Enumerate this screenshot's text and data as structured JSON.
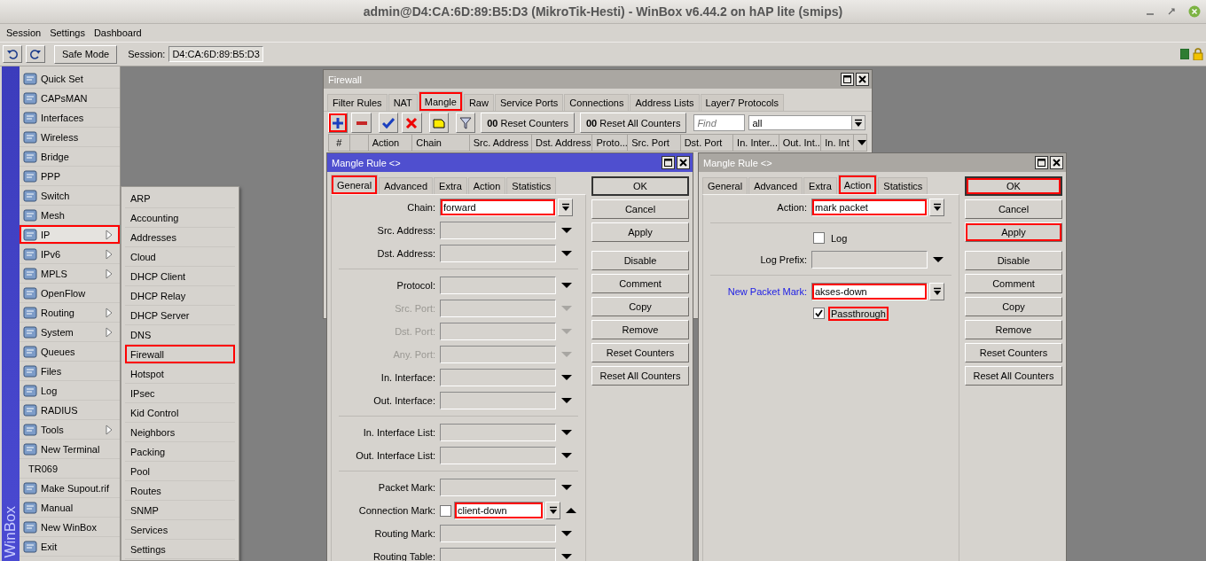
{
  "window": {
    "title": "admin@D4:CA:6D:89:B5:D3 (MikroTik-Hesti) - WinBox v6.44.2 on hAP lite (smips)"
  },
  "menu_bar": [
    "Session",
    "Settings",
    "Dashboard"
  ],
  "toolbar": {
    "safe_mode": "Safe Mode",
    "session_label": "Session:",
    "session_value": "D4:CA:6D:89:B5:D3"
  },
  "sidebar": {
    "brand": "WinBox",
    "items": [
      {
        "label": "Quick Set",
        "icon": true,
        "submenu": false,
        "selected": false,
        "highlighted": false
      },
      {
        "label": "CAPsMAN",
        "icon": true,
        "submenu": false,
        "selected": false,
        "highlighted": false
      },
      {
        "label": "Interfaces",
        "icon": true,
        "submenu": false,
        "selected": false,
        "highlighted": false
      },
      {
        "label": "Wireless",
        "icon": true,
        "submenu": false,
        "selected": false,
        "highlighted": false
      },
      {
        "label": "Bridge",
        "icon": true,
        "submenu": false,
        "selected": false,
        "highlighted": false
      },
      {
        "label": "PPP",
        "icon": true,
        "submenu": false,
        "selected": false,
        "highlighted": false
      },
      {
        "label": "Switch",
        "icon": true,
        "submenu": false,
        "selected": false,
        "highlighted": false
      },
      {
        "label": "Mesh",
        "icon": true,
        "submenu": false,
        "selected": false,
        "highlighted": false
      },
      {
        "label": "IP",
        "icon": true,
        "submenu": true,
        "selected": true,
        "highlighted": true
      },
      {
        "label": "IPv6",
        "icon": true,
        "submenu": true,
        "selected": false,
        "highlighted": false
      },
      {
        "label": "MPLS",
        "icon": true,
        "submenu": true,
        "selected": false,
        "highlighted": false
      },
      {
        "label": "OpenFlow",
        "icon": true,
        "submenu": false,
        "selected": false,
        "highlighted": false
      },
      {
        "label": "Routing",
        "icon": true,
        "submenu": true,
        "selected": false,
        "highlighted": false
      },
      {
        "label": "System",
        "icon": true,
        "submenu": true,
        "selected": false,
        "highlighted": false
      },
      {
        "label": "Queues",
        "icon": true,
        "submenu": false,
        "selected": false,
        "highlighted": false
      },
      {
        "label": "Files",
        "icon": true,
        "submenu": false,
        "selected": false,
        "highlighted": false
      },
      {
        "label": "Log",
        "icon": true,
        "submenu": false,
        "selected": false,
        "highlighted": false
      },
      {
        "label": "RADIUS",
        "icon": true,
        "submenu": false,
        "selected": false,
        "highlighted": false
      },
      {
        "label": "Tools",
        "icon": true,
        "submenu": true,
        "selected": false,
        "highlighted": false
      },
      {
        "label": "New Terminal",
        "icon": true,
        "submenu": false,
        "selected": false,
        "highlighted": false
      },
      {
        "label": "TR069",
        "icon": false,
        "submenu": false,
        "selected": false,
        "highlighted": false
      },
      {
        "label": "Make Supout.rif",
        "icon": true,
        "submenu": false,
        "selected": false,
        "highlighted": false
      },
      {
        "label": "Manual",
        "icon": true,
        "submenu": false,
        "selected": false,
        "highlighted": false
      },
      {
        "label": "New WinBox",
        "icon": true,
        "submenu": false,
        "selected": false,
        "highlighted": false
      },
      {
        "label": "Exit",
        "icon": true,
        "submenu": false,
        "selected": false,
        "highlighted": false
      }
    ]
  },
  "ip_menu": {
    "items": [
      {
        "label": "ARP",
        "highlighted": false
      },
      {
        "label": "Accounting",
        "highlighted": false
      },
      {
        "label": "Addresses",
        "highlighted": false
      },
      {
        "label": "Cloud",
        "highlighted": false
      },
      {
        "label": "DHCP Client",
        "highlighted": false
      },
      {
        "label": "DHCP Relay",
        "highlighted": false
      },
      {
        "label": "DHCP Server",
        "highlighted": false
      },
      {
        "label": "DNS",
        "highlighted": false
      },
      {
        "label": "Firewall",
        "highlighted": true
      },
      {
        "label": "Hotspot",
        "highlighted": false
      },
      {
        "label": "IPsec",
        "highlighted": false
      },
      {
        "label": "Kid Control",
        "highlighted": false
      },
      {
        "label": "Neighbors",
        "highlighted": false
      },
      {
        "label": "Packing",
        "highlighted": false
      },
      {
        "label": "Pool",
        "highlighted": false
      },
      {
        "label": "Routes",
        "highlighted": false
      },
      {
        "label": "SNMP",
        "highlighted": false
      },
      {
        "label": "Services",
        "highlighted": false
      },
      {
        "label": "Settings",
        "highlighted": false
      }
    ]
  },
  "firewall": {
    "title": "Firewall",
    "active": false,
    "tabs": [
      {
        "label": "Filter Rules",
        "selected": false,
        "highlighted": false
      },
      {
        "label": "NAT",
        "selected": false,
        "highlighted": false
      },
      {
        "label": "Mangle",
        "selected": true,
        "highlighted": true
      },
      {
        "label": "Raw",
        "selected": false,
        "highlighted": false
      },
      {
        "label": "Service Ports",
        "selected": false,
        "highlighted": false
      },
      {
        "label": "Connections",
        "selected": false,
        "highlighted": false
      },
      {
        "label": "Address Lists",
        "selected": false,
        "highlighted": false
      },
      {
        "label": "Layer7 Protocols",
        "selected": false,
        "highlighted": false
      }
    ],
    "tools": [
      {
        "kind": "add",
        "highlighted": true
      },
      {
        "kind": "remove",
        "highlighted": false
      },
      {
        "kind": "enable",
        "highlighted": false
      },
      {
        "kind": "disable",
        "highlighted": false
      },
      {
        "kind": "comment",
        "highlighted": false
      },
      {
        "kind": "filter",
        "highlighted": false
      }
    ],
    "counter_buttons": [
      {
        "prefix": "00",
        "label": "Reset Counters"
      },
      {
        "prefix": "00",
        "label": "Reset All Counters"
      }
    ],
    "find": {
      "placeholder": "Find"
    },
    "filter_value": "all",
    "columns": [
      "#",
      "Action",
      "Chain",
      "Src. Address",
      "Dst. Address",
      "Proto...",
      "Src. Port",
      "Dst. Port",
      "In. Inter...",
      "Out. Int...",
      "In. Int"
    ]
  },
  "dialogs": [
    {
      "title": "Mangle Rule <>",
      "active": true,
      "tabs": [
        {
          "label": "General",
          "selected": true,
          "highlighted": true
        },
        {
          "label": "Advanced",
          "selected": false,
          "highlighted": false
        },
        {
          "label": "Extra",
          "selected": false,
          "highlighted": false
        },
        {
          "label": "Action",
          "selected": false,
          "highlighted": false
        },
        {
          "label": "Statistics",
          "selected": false,
          "highlighted": false
        }
      ],
      "rows": [
        {
          "kind": "combo",
          "label": "Chain:",
          "value": "forward",
          "disabled": false,
          "highlighted": true
        },
        {
          "kind": "select",
          "label": "Src. Address:",
          "disabled": false,
          "highlighted": false
        },
        {
          "kind": "select",
          "label": "Dst. Address:",
          "disabled": false,
          "highlighted": false
        },
        {
          "kind": "separator"
        },
        {
          "kind": "select",
          "label": "Protocol:",
          "disabled": false,
          "highlighted": false
        },
        {
          "kind": "select",
          "label": "Src. Port:",
          "disabled": true,
          "highlighted": false
        },
        {
          "kind": "select",
          "label": "Dst. Port:",
          "disabled": true,
          "highlighted": false
        },
        {
          "kind": "select",
          "label": "Any. Port:",
          "disabled": true,
          "highlighted": false
        },
        {
          "kind": "select",
          "label": "In. Interface:",
          "disabled": false,
          "highlighted": false
        },
        {
          "kind": "select",
          "label": "Out. Interface:",
          "disabled": false,
          "highlighted": false
        },
        {
          "kind": "separator"
        },
        {
          "kind": "select",
          "label": "In. Interface List:",
          "disabled": false,
          "highlighted": false
        },
        {
          "kind": "select",
          "label": "Out. Interface List:",
          "disabled": false,
          "highlighted": false
        },
        {
          "kind": "separator"
        },
        {
          "kind": "select",
          "label": "Packet Mark:",
          "disabled": false,
          "highlighted": false
        },
        {
          "kind": "combo",
          "label": "Connection Mark:",
          "value": "client-down",
          "negate": {
            "checked": false
          },
          "expanded": true,
          "disabled": false,
          "highlighted": true
        },
        {
          "kind": "select",
          "label": "Routing Mark:",
          "disabled": false,
          "highlighted": false
        },
        {
          "kind": "select",
          "label": "Routing Table:",
          "disabled": false,
          "highlighted": false
        }
      ],
      "button_groups": [
        [
          {
            "label": "OK",
            "default": true,
            "highlighted": false
          },
          {
            "label": "Cancel",
            "default": false,
            "highlighted": false
          },
          {
            "label": "Apply",
            "default": false,
            "highlighted": false
          }
        ],
        [
          {
            "label": "Disable",
            "default": false,
            "highlighted": false
          },
          {
            "label": "Comment",
            "default": false,
            "highlighted": false
          },
          {
            "label": "Copy",
            "default": false,
            "highlighted": false
          },
          {
            "label": "Remove",
            "default": false,
            "highlighted": false
          },
          {
            "label": "Reset Counters",
            "default": false,
            "highlighted": false
          },
          {
            "label": "Reset All Counters",
            "default": false,
            "highlighted": false
          }
        ]
      ]
    },
    {
      "title": "Mangle Rule <>",
      "active": false,
      "tabs": [
        {
          "label": "General",
          "selected": false,
          "highlighted": false
        },
        {
          "label": "Advanced",
          "selected": false,
          "highlighted": false
        },
        {
          "label": "Extra",
          "selected": false,
          "highlighted": false
        },
        {
          "label": "Action",
          "selected": true,
          "highlighted": true
        },
        {
          "label": "Statistics",
          "selected": false,
          "highlighted": false
        }
      ],
      "rows": [
        {
          "kind": "combo",
          "label": "Action:",
          "value": "mark packet",
          "disabled": false,
          "highlighted": true
        },
        {
          "kind": "separator"
        },
        {
          "kind": "checkbox",
          "label": "Log",
          "checked": false,
          "highlighted": false
        },
        {
          "kind": "select",
          "label": "Log Prefix:",
          "disabled": false,
          "highlighted": false
        },
        {
          "kind": "separator"
        },
        {
          "kind": "combo",
          "label": "New Packet Mark:",
          "value": "akses-down",
          "emphasized": true,
          "disabled": false,
          "highlighted": true
        },
        {
          "kind": "checkbox",
          "label": "Passthrough",
          "checked": true,
          "highlighted": true
        }
      ],
      "button_groups": [
        [
          {
            "label": "OK",
            "default": true,
            "highlighted": true
          },
          {
            "label": "Cancel",
            "default": false,
            "highlighted": false
          },
          {
            "label": "Apply",
            "default": false,
            "highlighted": true
          }
        ],
        [
          {
            "label": "Disable",
            "default": false,
            "highlighted": false
          },
          {
            "label": "Comment",
            "default": false,
            "highlighted": false
          },
          {
            "label": "Copy",
            "default": false,
            "highlighted": false
          },
          {
            "label": "Remove",
            "default": false,
            "highlighted": false
          },
          {
            "label": "Reset Counters",
            "default": false,
            "highlighted": false
          },
          {
            "label": "Reset All Counters",
            "default": false,
            "highlighted": false
          }
        ]
      ]
    }
  ]
}
